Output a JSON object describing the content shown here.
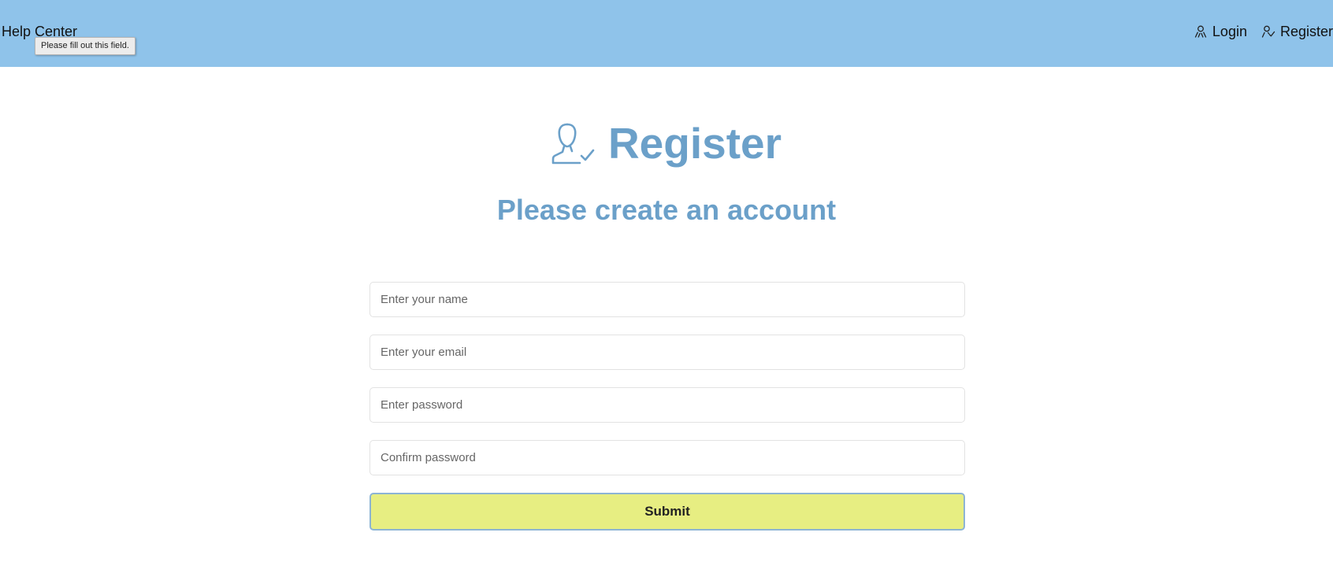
{
  "header": {
    "brand": "Help Center",
    "tooltip": "Please fill out this field.",
    "nav": [
      {
        "label": "Login",
        "icon": "login-user-icon"
      },
      {
        "label": "Register",
        "icon": "register-user-icon"
      }
    ]
  },
  "main": {
    "icon": "user-check-icon",
    "title": "Register",
    "subtitle": "Please create an account"
  },
  "form": {
    "name_placeholder": "Enter your name",
    "email_placeholder": "Enter your email",
    "password_placeholder": "Enter password",
    "confirm_placeholder": "Confirm password",
    "submit_label": "Submit"
  },
  "colors": {
    "header_bg": "#8fc3ea",
    "accent": "#6ba0c9",
    "submit_bg": "#e7ee82"
  }
}
